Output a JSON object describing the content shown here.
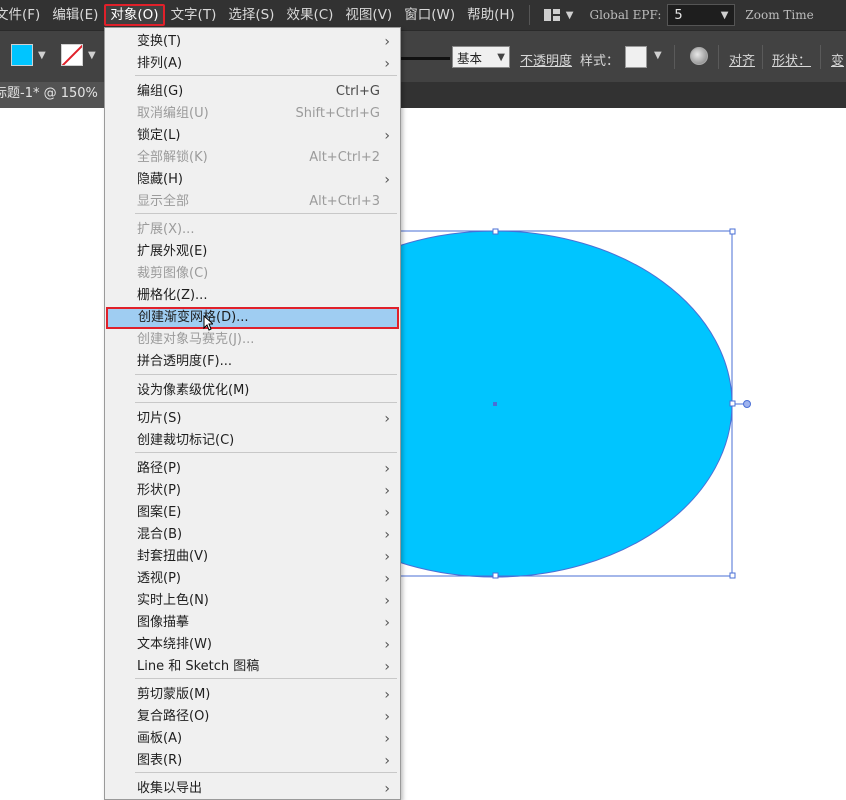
{
  "menubar": {
    "items": [
      "文件(F)",
      "编辑(E)",
      "对象(O)",
      "文字(T)",
      "选择(S)",
      "效果(C)",
      "视图(V)",
      "窗口(W)",
      "帮助(H)"
    ],
    "active_item": "对象(O)",
    "global_epf_label": "Global EPF:",
    "global_epf_value": "5",
    "zoom_label": "Zoom Time"
  },
  "controlbar": {
    "fill_color": "#00c5ff",
    "stroke_profile": "基本",
    "opacity_label": "不透明度",
    "style_label": "样式：",
    "align_label": "对齐",
    "shape_label": "形状：",
    "transform_label": "变"
  },
  "document": {
    "tab_title": "标题-1* @ 150%"
  },
  "artwork": {
    "ellipse_color": "#00c5ff",
    "selection_color": "#4a6fd6"
  },
  "object_menu": {
    "items": [
      {
        "label": "变换(T)",
        "shortcut": "",
        "submenu": true,
        "enabled": true
      },
      {
        "label": "排列(A)",
        "shortcut": "",
        "submenu": true,
        "enabled": true
      },
      {
        "label": "编组(G)",
        "shortcut": "Ctrl+G",
        "submenu": false,
        "enabled": true
      },
      {
        "label": "取消编组(U)",
        "shortcut": "Shift+Ctrl+G",
        "submenu": false,
        "enabled": false
      },
      {
        "label": "锁定(L)",
        "shortcut": "",
        "submenu": true,
        "enabled": true
      },
      {
        "label": "全部解锁(K)",
        "shortcut": "Alt+Ctrl+2",
        "submenu": false,
        "enabled": false
      },
      {
        "label": "隐藏(H)",
        "shortcut": "",
        "submenu": true,
        "enabled": true
      },
      {
        "label": "显示全部",
        "shortcut": "Alt+Ctrl+3",
        "submenu": false,
        "enabled": false
      },
      {
        "label": "扩展(X)...",
        "shortcut": "",
        "submenu": false,
        "enabled": false
      },
      {
        "label": "扩展外观(E)",
        "shortcut": "",
        "submenu": false,
        "enabled": true
      },
      {
        "label": "裁剪图像(C)",
        "shortcut": "",
        "submenu": false,
        "enabled": false
      },
      {
        "label": "栅格化(Z)...",
        "shortcut": "",
        "submenu": false,
        "enabled": true
      },
      {
        "label": "创建渐变网格(D)...",
        "shortcut": "",
        "submenu": false,
        "enabled": true,
        "highlighted": true
      },
      {
        "label": "创建对象马赛克(J)...",
        "shortcut": "",
        "submenu": false,
        "enabled": false
      },
      {
        "label": "拼合透明度(F)...",
        "shortcut": "",
        "submenu": false,
        "enabled": true
      },
      {
        "label": "设为像素级优化(M)",
        "shortcut": "",
        "submenu": false,
        "enabled": true
      },
      {
        "label": "切片(S)",
        "shortcut": "",
        "submenu": true,
        "enabled": true
      },
      {
        "label": "创建裁切标记(C)",
        "shortcut": "",
        "submenu": false,
        "enabled": true
      },
      {
        "label": "路径(P)",
        "shortcut": "",
        "submenu": true,
        "enabled": true
      },
      {
        "label": "形状(P)",
        "shortcut": "",
        "submenu": true,
        "enabled": true
      },
      {
        "label": "图案(E)",
        "shortcut": "",
        "submenu": true,
        "enabled": true
      },
      {
        "label": "混合(B)",
        "shortcut": "",
        "submenu": true,
        "enabled": true
      },
      {
        "label": "封套扭曲(V)",
        "shortcut": "",
        "submenu": true,
        "enabled": true
      },
      {
        "label": "透视(P)",
        "shortcut": "",
        "submenu": true,
        "enabled": true
      },
      {
        "label": "实时上色(N)",
        "shortcut": "",
        "submenu": true,
        "enabled": true
      },
      {
        "label": "图像描摹",
        "shortcut": "",
        "submenu": true,
        "enabled": true
      },
      {
        "label": "文本绕排(W)",
        "shortcut": "",
        "submenu": true,
        "enabled": true
      },
      {
        "label": "Line 和 Sketch 图稿",
        "shortcut": "",
        "submenu": true,
        "enabled": true
      },
      {
        "label": "剪切蒙版(M)",
        "shortcut": "",
        "submenu": true,
        "enabled": true
      },
      {
        "label": "复合路径(O)",
        "shortcut": "",
        "submenu": true,
        "enabled": true
      },
      {
        "label": "画板(A)",
        "shortcut": "",
        "submenu": true,
        "enabled": true
      },
      {
        "label": "图表(R)",
        "shortcut": "",
        "submenu": true,
        "enabled": true
      },
      {
        "label": "收集以导出",
        "shortcut": "",
        "submenu": true,
        "enabled": true
      }
    ]
  }
}
